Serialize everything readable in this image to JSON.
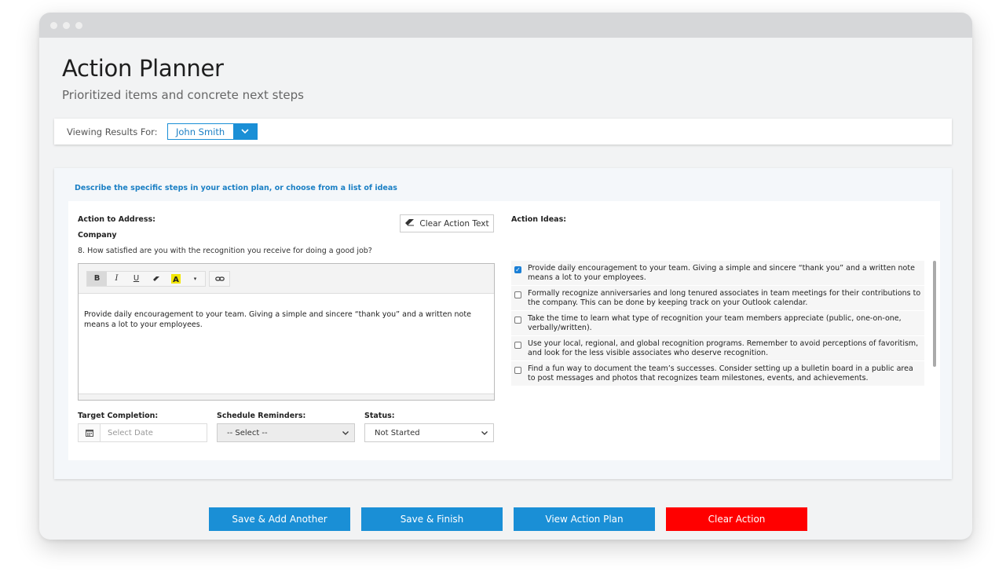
{
  "page": {
    "title": "Action Planner",
    "subtitle": "Prioritized items and concrete next steps"
  },
  "viewing": {
    "label": "Viewing Results For:",
    "selected_user": "John Smith"
  },
  "card": {
    "heading": "Describe the specific steps in your action plan, or choose from a list of ideas",
    "action_to_address_label": "Action to Address:",
    "category": "Company",
    "question": "8. How satisfied are you with the recognition you receive for doing a good job?",
    "clear_action_text_label": "Clear Action Text",
    "editor": {
      "toolbar": [
        "B",
        "I",
        "U"
      ],
      "content": "Provide daily encouragement to your team. Giving a simple and sincere “thank you” and a written note means a lot to your employees."
    },
    "target_completion_label": "Target Completion:",
    "date_placeholder": "Select Date",
    "schedule_reminders_label": "Schedule Reminders:",
    "reminders_value": "-- Select --",
    "status_label": "Status:",
    "status_value": "Not Started",
    "action_ideas_label": "Action Ideas:",
    "ideas": [
      {
        "text": "Provide daily encouragement to your team. Giving a simple and sincere “thank you” and a written note means a lot to your employees.",
        "checked": true
      },
      {
        "text": "Formally recognize anniversaries and long tenured associates in team meetings for their contributions to the company. This can be done by keeping track on your Outlook calendar.",
        "checked": false
      },
      {
        "text": "Take the time to learn what type of recognition your team members appreciate (public, one-on-one, verbally/written).",
        "checked": false
      },
      {
        "text": "Use your local, regional, and global recognition programs. Remember to avoid perceptions of favoritism, and look for the less visible associates who deserve recognition.",
        "checked": false
      },
      {
        "text": "Find a fun way to document the team’s successes. Consider setting up a bulletin board in a public area to post messages and photos that recognizes team milestones, events, and achievements.",
        "checked": false
      }
    ]
  },
  "actions": {
    "save_add_another": "Save & Add Another",
    "save_finish": "Save & Finish",
    "view_action_plan": "View Action Plan",
    "clear_action": "Clear Action"
  },
  "colors": {
    "accent": "#1a8fd6",
    "danger": "#ff0000"
  }
}
